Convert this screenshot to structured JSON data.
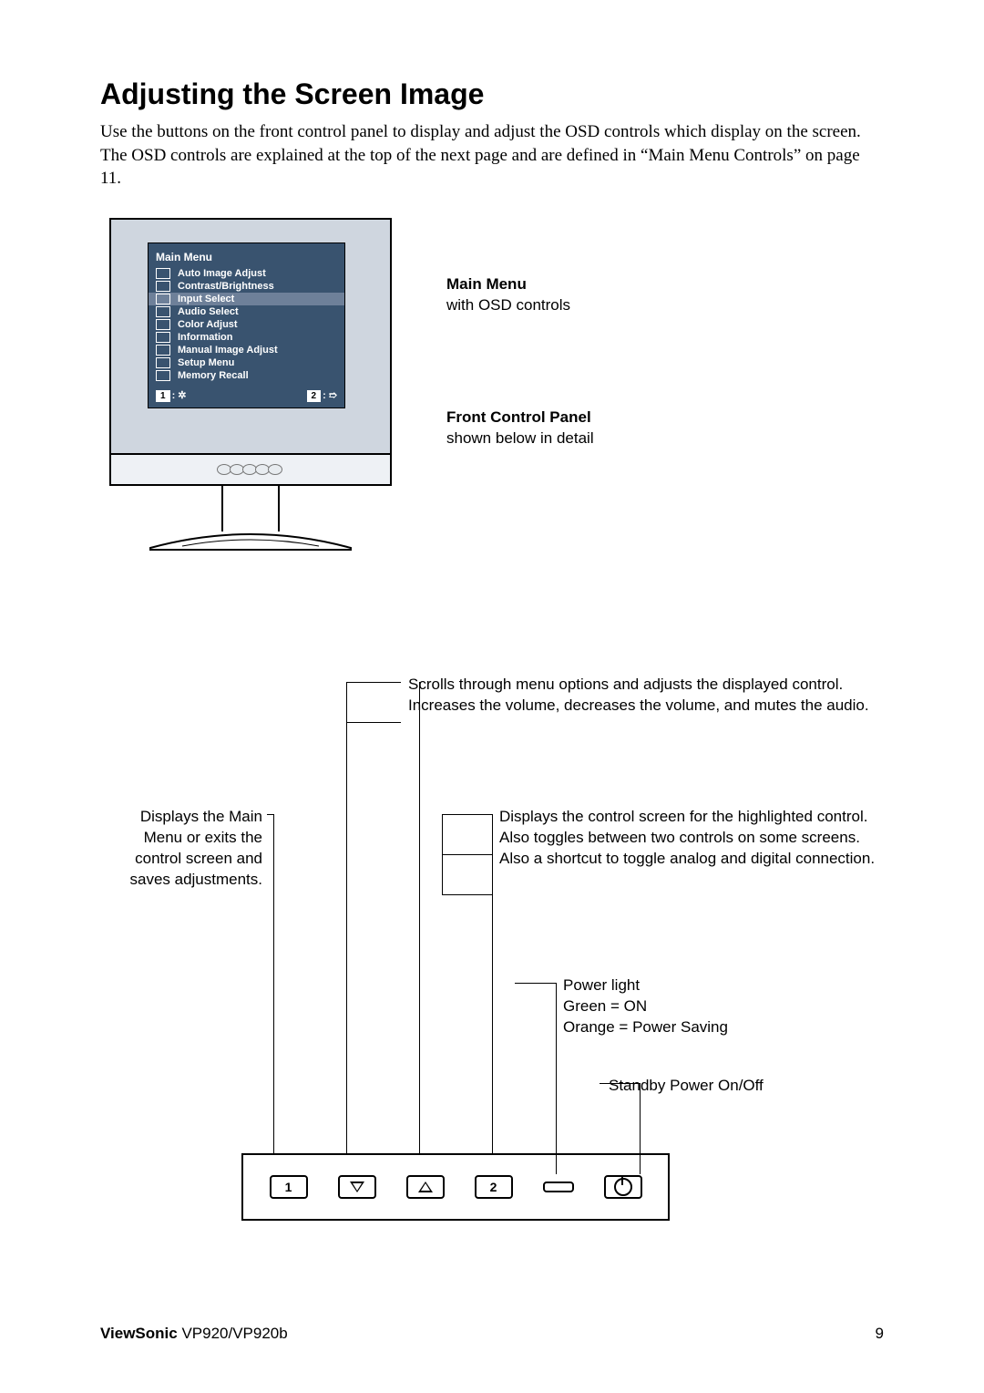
{
  "title": "Adjusting the Screen Image",
  "intro": "Use the buttons on the front control panel to display and adjust the OSD controls which display on the screen. The OSD controls are explained at the top of the next page and are defined in “Main Menu Controls” on page 11.",
  "osd": {
    "title": "Main Menu",
    "items": [
      "Auto Image Adjust",
      "Contrast/Brightness",
      "Input Select",
      "Audio Select",
      "Color Adjust",
      "Information",
      "Manual Image Adjust",
      "Setup Menu",
      "Memory Recall"
    ],
    "foot_left": "1",
    "foot_right": "2"
  },
  "labels": {
    "main_menu_hd": "Main Menu",
    "main_menu_sub": "with OSD controls",
    "front_panel_hd": "Front Control Panel",
    "front_panel_sub": "shown below in detail"
  },
  "notes": {
    "left": "Displays the Main Menu or exits the control screen and saves adjustments.",
    "scroll1": "Scrolls through menu options and adjusts the displayed control.",
    "scroll2": "Increases the volume, decreases the volume, and mutes the audio.",
    "btn2_a": "Displays the control screen for the highlighted control.",
    "btn2_b": "Also toggles between two controls on some screens.",
    "btn2_c": "Also a shortcut to toggle analog and digital connection.",
    "power_light": "Power light",
    "power_on": "Green = ON",
    "power_save": "Orange = Power Saving",
    "standby": "Standby Power On/Off"
  },
  "buttons": {
    "b1": "1",
    "b2": "2"
  },
  "footer": {
    "brand": "ViewSonic",
    "model": " VP920/VP920b",
    "page": "9"
  }
}
